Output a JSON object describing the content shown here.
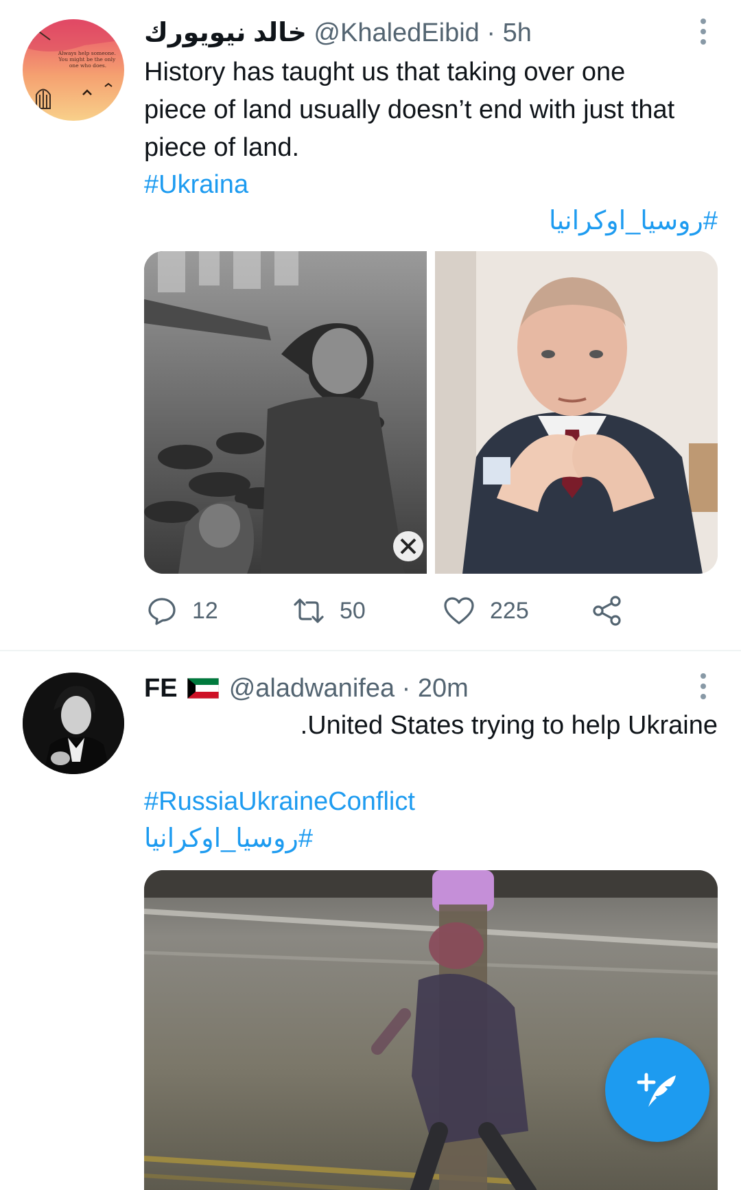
{
  "tweets": [
    {
      "display_name": "خالد نيويورك",
      "handle": "@KhaledEibid",
      "separator": "·",
      "time": "5h",
      "text": "History has taught us that taking over one piece of land usually doesn’t end with just that piece of land.",
      "hashtags": [
        "#Ukraina",
        "#روسيا_اوكرانيا"
      ],
      "avatar_text": "Always help someone. You might be the only one who does.",
      "counts": {
        "replies": "12",
        "retweets": "50",
        "likes": "225"
      }
    },
    {
      "display_name": "FE",
      "handle": "@aladwanifea",
      "separator": "·",
      "time": "20m",
      "text": ".United States trying to help Ukraine",
      "hashtags": [
        "#RussiaUkraineConflict",
        "روسيا_اوكرانيا#"
      ]
    }
  ],
  "colors": {
    "accent": "#1d9bf0",
    "secondary_text": "#536471"
  },
  "icons": [
    "more-icon",
    "reply-icon",
    "retweet-icon",
    "like-icon",
    "share-icon",
    "compose-tweet-icon",
    "kuwait-flag-icon"
  ]
}
